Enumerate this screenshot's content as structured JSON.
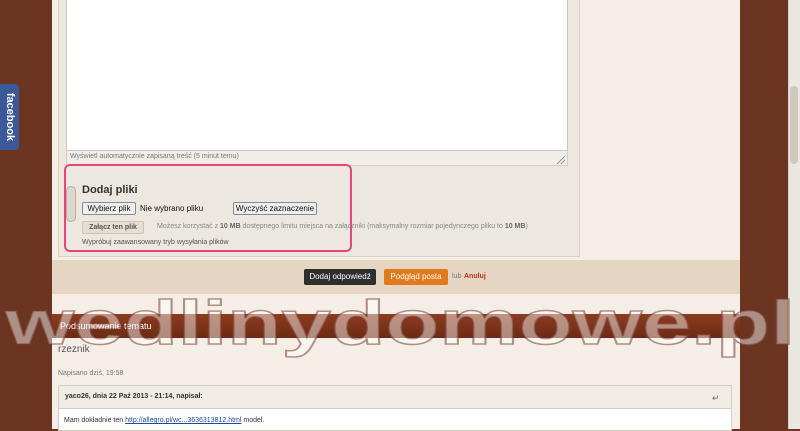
{
  "facebook": {
    "label": "facebook"
  },
  "editor": {
    "status": "Wyświetl automatycznie zapisaną treść (5 minut temu)"
  },
  "attachments": {
    "title": "Dodaj pliki",
    "choose_label": "Wybierz plik",
    "no_file_label": "Nie wybrano pliku",
    "clear_label": "Wyczyść zaznaczenie",
    "attach_label": "Załącz ten plik",
    "limit_prefix": "Możesz korzystać z ",
    "limit_value": "10 MB",
    "limit_middle": " dostępnego limitu miejsca na załączniki (maksymalny rozmiar pojedynczego pliku to ",
    "limit_max": "10 MB",
    "limit_suffix": ")",
    "advanced_label": "Wypróbuj zaawansowany tryb wysyłania plików"
  },
  "actions": {
    "reply_label": "Dodaj odpowiedź",
    "preview_label": "Podgląd posta",
    "or_label": "lub",
    "cancel_label": "Anuluj"
  },
  "summary": {
    "title": "Podsumowanie tematu",
    "poster": "rzeznik",
    "posted": "Napisano dziś, 19:58",
    "quote_header": "yaco26, dnia 22 Paź 2013 - 21:14, napisał:",
    "quote_prefix": "Mam dokładnie ten ",
    "quote_link": "http://allegro.pl/wc...3636313812.html",
    "quote_suffix": " model."
  },
  "watermark": {
    "text": "wedlinydomowe.pl"
  }
}
